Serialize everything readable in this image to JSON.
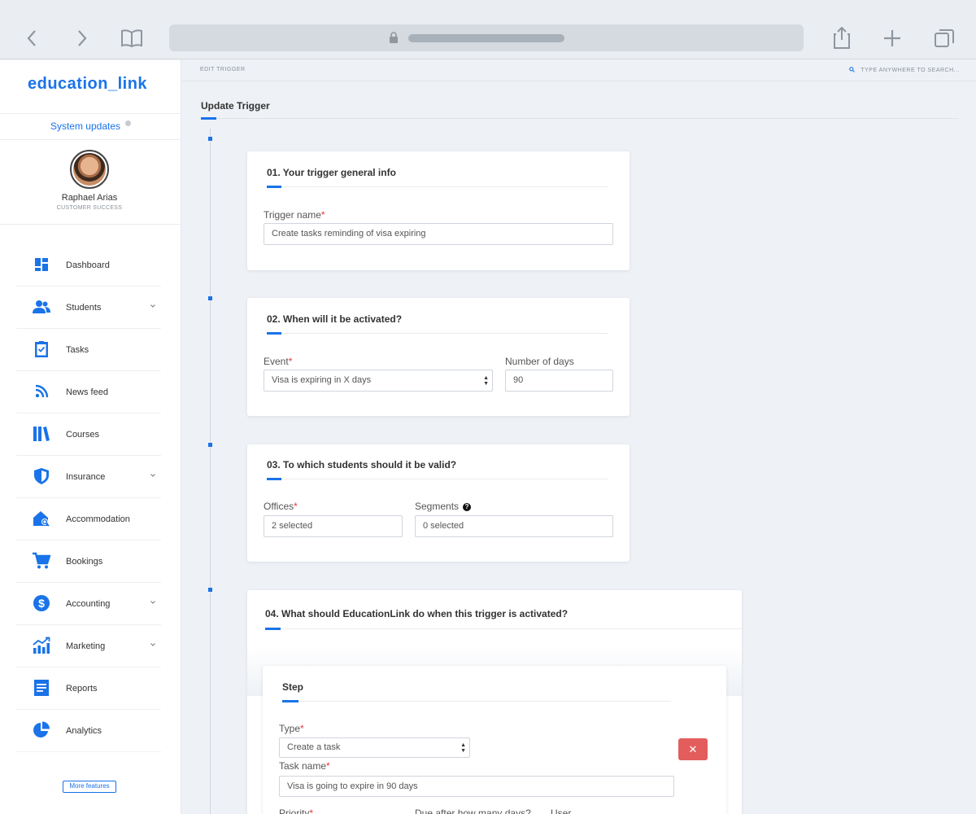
{
  "app": {
    "logo": "education_link",
    "system_updates": "System updates",
    "more_features": "More features"
  },
  "user": {
    "name": "Raphael Arias",
    "role": "CUSTOMER SUCCESS"
  },
  "nav": [
    {
      "label": "Dashboard",
      "icon": "dashboard-icon",
      "has_submenu": false
    },
    {
      "label": "Students",
      "icon": "students-icon",
      "has_submenu": true
    },
    {
      "label": "Tasks",
      "icon": "tasks-icon",
      "has_submenu": false
    },
    {
      "label": "News feed",
      "icon": "news-feed-icon",
      "has_submenu": false
    },
    {
      "label": "Courses",
      "icon": "courses-icon",
      "has_submenu": false
    },
    {
      "label": "Insurance",
      "icon": "insurance-icon",
      "has_submenu": true
    },
    {
      "label": "Accommodation",
      "icon": "accommodation-icon",
      "has_submenu": false
    },
    {
      "label": "Bookings",
      "icon": "cart-icon",
      "has_submenu": false
    },
    {
      "label": "Accounting",
      "icon": "dollar-icon",
      "has_submenu": true
    },
    {
      "label": "Marketing",
      "icon": "marketing-chart-icon",
      "has_submenu": true
    },
    {
      "label": "Reports",
      "icon": "reports-icon",
      "has_submenu": false
    },
    {
      "label": "Analytics",
      "icon": "pie-chart-icon",
      "has_submenu": false
    }
  ],
  "topbar": {
    "breadcrumb": "EDIT TRIGGER",
    "search_placeholder": "TYPE ANYWHERE TO SEARCH..."
  },
  "page": {
    "title": "Update Trigger"
  },
  "section1": {
    "title": "01. Your trigger general info",
    "trigger_name_label": "Trigger name",
    "trigger_name_value": "Create tasks reminding of visa expiring"
  },
  "section2": {
    "title": "02. When will it be activated?",
    "event_label": "Event",
    "event_value": "Visa is expiring in X days",
    "days_label": "Number of days",
    "days_value": "90"
  },
  "section3": {
    "title": "03. To which students should it be valid?",
    "offices_label": "Offices",
    "offices_value": "2 selected",
    "segments_label": "Segments",
    "segments_value": "0 selected"
  },
  "section4": {
    "title": "04. What should EducationLink do when this trigger is activated?",
    "step": {
      "title": "Step",
      "type_label": "Type",
      "type_value": "Create a task",
      "task_name_label": "Task name",
      "task_name_value": "Visa is going to expire in 90 days",
      "priority_label": "Priority",
      "due_label": "Due after how many days?",
      "user_label": "User"
    }
  },
  "colors": {
    "accent": "#1a73e8",
    "danger": "#e35d5d",
    "required": "#e53935"
  }
}
